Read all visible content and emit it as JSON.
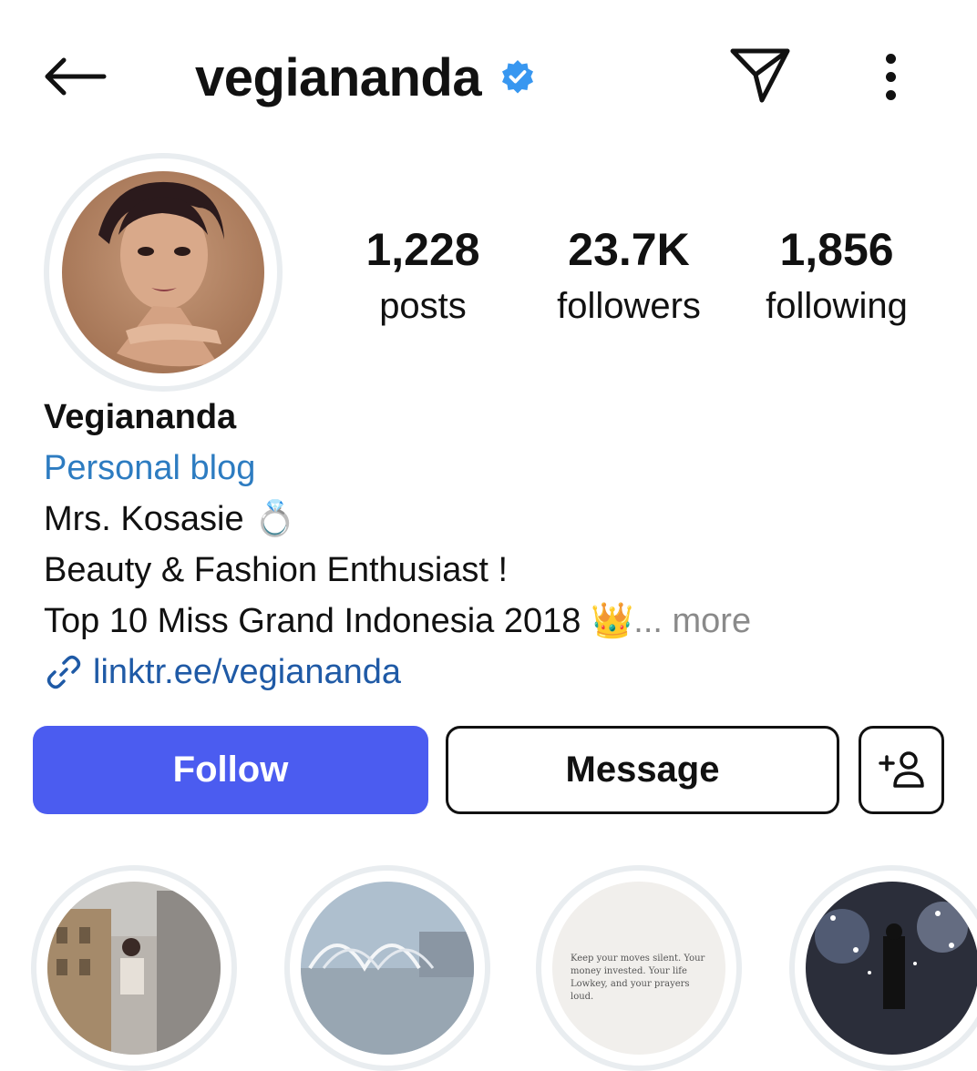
{
  "header": {
    "username": "vegiananda",
    "verified": true,
    "back_icon": "arrow-left-icon",
    "send_icon": "paper-plane-icon",
    "more_icon": "more-vertical-icon"
  },
  "stats": [
    {
      "value": "1,228",
      "label": "posts"
    },
    {
      "value": "23.7K",
      "label": "followers"
    },
    {
      "value": "1,856",
      "label": "following"
    }
  ],
  "bio": {
    "display_name": "Vegiananda",
    "category": "Personal blog",
    "line1": "Mrs. Kosasie",
    "line1_emoji": "💍",
    "line2": "Beauty & Fashion Enthusiast !",
    "line3": "Top 10 Miss Grand Indonesia 2018",
    "line3_emoji": "👑",
    "more": "... more",
    "link": "linktr.ee/vegiananda"
  },
  "buttons": {
    "follow": "Follow",
    "message": "Message"
  },
  "highlights": {
    "quote": "Keep your moves silent. Your money invested. Your life Lowkey, and your prayers loud."
  },
  "colors": {
    "follow_bg": "#4b5cf0",
    "link": "#1f5aa6",
    "category": "#2d7cc1",
    "verified": "#3897f0",
    "ring": "#e9edf0"
  }
}
